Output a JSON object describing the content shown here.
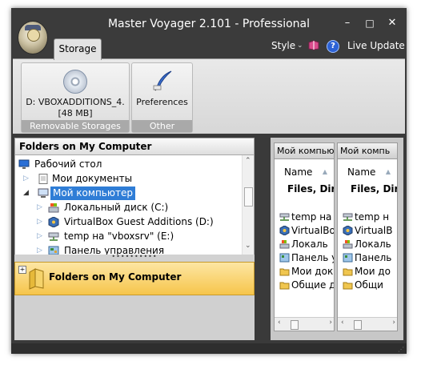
{
  "window": {
    "title": "Master Voyager 2.101 - Professional"
  },
  "title_controls": {
    "minimize": "–",
    "maximize": "□",
    "close": "✕"
  },
  "tabs": [
    {
      "label": "Storage",
      "active": true
    }
  ],
  "menu": {
    "style": "Style",
    "live_update": "Live Update"
  },
  "ribbon": {
    "groups": [
      {
        "caption": "Removable Storages",
        "button_label": "D: VBOXADDITIONS_4.",
        "button_sub": "[48 MB]",
        "icon": "cd-disc-icon"
      },
      {
        "caption": "Other",
        "button_label": "Preferences",
        "icon": "quill-pen-icon"
      }
    ]
  },
  "left_pane": {
    "header": "Folders on My Computer",
    "tree": [
      {
        "label": "Рабочий стол",
        "icon": "desktop-icon",
        "level": 0,
        "expander": ""
      },
      {
        "label": "Мои документы",
        "icon": "documents-icon",
        "level": 1,
        "expander": "▷"
      },
      {
        "label": "Мой компьютер",
        "icon": "computer-icon",
        "level": 1,
        "expander": "◢",
        "selected": true
      },
      {
        "label": "Локальный диск (C:)",
        "icon": "drive-icon",
        "level": 2,
        "expander": "▷"
      },
      {
        "label": "VirtualBox Guest Additions (D:)",
        "icon": "cd-drive-icon",
        "level": 2,
        "expander": "▷"
      },
      {
        "label": "temp на \"vboxsrv\" (E:)",
        "icon": "network-drive-icon",
        "level": 2,
        "expander": "▷"
      },
      {
        "label": "Панель управления",
        "icon": "control-panel-icon",
        "level": 2,
        "expander": "▷"
      }
    ],
    "folders_band": "Folders on My Computer"
  },
  "right_panes": [
    {
      "header": "Мой компьютер",
      "column": "Name",
      "group": "Files, Dire",
      "rows": [
        {
          "label": "temp на",
          "icon": "network-drive-icon"
        },
        {
          "label": "VirtualBo",
          "icon": "cd-drive-icon"
        },
        {
          "label": "Локаль",
          "icon": "drive-icon"
        },
        {
          "label": "Панель у",
          "icon": "control-panel-icon"
        },
        {
          "label": "Мои док",
          "icon": "folder-icon"
        },
        {
          "label": "Общие д",
          "icon": "folder-icon"
        }
      ]
    },
    {
      "header": "Мой компь",
      "column": "Name",
      "group": "Files, Dir",
      "rows": [
        {
          "label": "temp н",
          "icon": "network-drive-icon"
        },
        {
          "label": "VirtualB",
          "icon": "cd-drive-icon"
        },
        {
          "label": "Локаль",
          "icon": "drive-icon"
        },
        {
          "label": "Панель",
          "icon": "control-panel-icon"
        },
        {
          "label": "Мои до",
          "icon": "folder-icon"
        },
        {
          "label": "Общи",
          "icon": "folder-icon"
        }
      ]
    }
  ],
  "colors": {
    "selection": "#2f7dd6",
    "band_top": "#fde6a3",
    "band_bottom": "#f6c54b",
    "chrome": "#3b3b3b"
  }
}
